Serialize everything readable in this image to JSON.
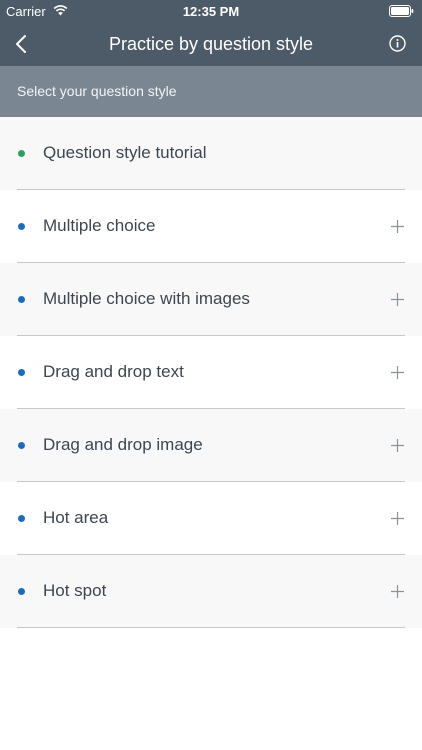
{
  "status_bar": {
    "carrier": "Carrier",
    "time": "12:35 PM"
  },
  "navbar": {
    "title": "Practice by question style",
    "back_icon": "chevron-left-icon",
    "info_icon": "info-circle-icon"
  },
  "subheader": {
    "text": "Select your question style"
  },
  "colors": {
    "topbar": "#4d5a67",
    "subheader": "#7a8793",
    "bullet_green": "#2e9f5e",
    "bullet_blue": "#1e6bb8"
  },
  "list": {
    "items": [
      {
        "label": "Question style tutorial",
        "bullet": "green",
        "expandable": false
      },
      {
        "label": "Multiple choice",
        "bullet": "blue",
        "expandable": true
      },
      {
        "label": "Multiple choice with images",
        "bullet": "blue",
        "expandable": true
      },
      {
        "label": "Drag and drop text",
        "bullet": "blue",
        "expandable": true
      },
      {
        "label": "Drag and drop image",
        "bullet": "blue",
        "expandable": true
      },
      {
        "label": "Hot area",
        "bullet": "blue",
        "expandable": true
      },
      {
        "label": "Hot spot",
        "bullet": "blue",
        "expandable": true
      }
    ]
  }
}
